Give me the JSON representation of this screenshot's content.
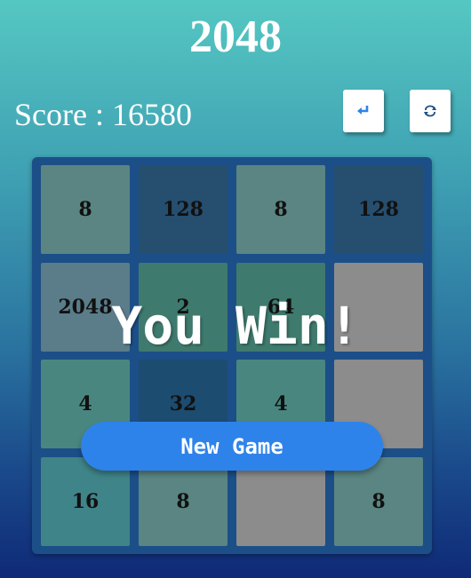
{
  "header": {
    "title": "2048",
    "score_text": "Score : 16580"
  },
  "controls": {
    "undo_icon": "undo-arrow-icon",
    "restart_icon": "refresh-icon"
  },
  "board": {
    "rows": [
      [
        {
          "value": "8",
          "color": "#5a8582"
        },
        {
          "value": "128",
          "color": "#264e6f"
        },
        {
          "value": "8",
          "color": "#5a8582"
        },
        {
          "value": "128",
          "color": "#264e6f"
        }
      ],
      [
        {
          "value": "2048",
          "color": "#5b7c89"
        },
        {
          "value": "2",
          "color": "#3f7a6e"
        },
        {
          "value": "64",
          "color": "#3f7a6e"
        },
        {
          "value": "",
          "color": "#8c8c8c"
        }
      ],
      [
        {
          "value": "4",
          "color": "#4a8680"
        },
        {
          "value": "32",
          "color": "#1c4c70"
        },
        {
          "value": "4",
          "color": "#4a8680"
        },
        {
          "value": "",
          "color": "#8c8c8c"
        }
      ],
      [
        {
          "value": "16",
          "color": "#3f8489"
        },
        {
          "value": "8",
          "color": "#5a8582"
        },
        {
          "value": "",
          "color": "#8c8c8c"
        },
        {
          "value": "8",
          "color": "#5a8582"
        }
      ]
    ]
  },
  "overlay": {
    "message": "You Win!",
    "button_label": "New Game"
  },
  "colors": {
    "button": "#2e83ea",
    "board": "#1c4f88",
    "empty_tile": "#8c8c8c"
  }
}
